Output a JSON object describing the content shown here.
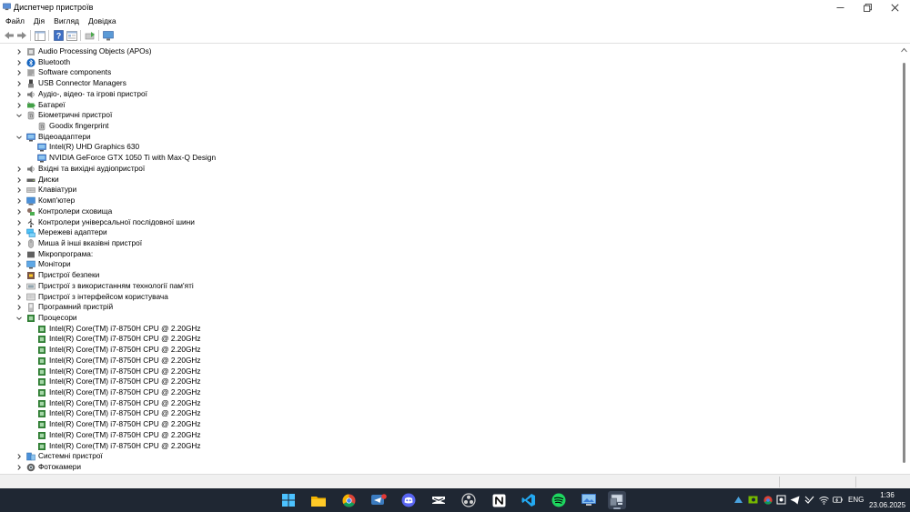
{
  "window": {
    "title": "Диспетчер пристроїв",
    "menu": [
      "Файл",
      "Дія",
      "Вигляд",
      "Довідка"
    ]
  },
  "tree": [
    {
      "level": 1,
      "expand": "collapsed",
      "icon": "audio-processing-icon",
      "label": "Audio Processing Objects (APOs)"
    },
    {
      "level": 1,
      "expand": "collapsed",
      "icon": "bluetooth-icon",
      "label": "Bluetooth"
    },
    {
      "level": 1,
      "expand": "collapsed",
      "icon": "software-component-icon",
      "label": "Software components"
    },
    {
      "level": 1,
      "expand": "collapsed",
      "icon": "usb-connector-icon",
      "label": "USB Connector Managers"
    },
    {
      "level": 1,
      "expand": "collapsed",
      "icon": "speaker-icon",
      "label": "Аудіо-, відео- та ігрові пристрої"
    },
    {
      "level": 1,
      "expand": "collapsed",
      "icon": "battery-icon",
      "label": "Батареї"
    },
    {
      "level": 1,
      "expand": "expanded",
      "icon": "biometric-icon",
      "label": "Біометричні пристрої"
    },
    {
      "level": 2,
      "expand": "none",
      "icon": "biometric-icon",
      "label": "Goodix fingerprint"
    },
    {
      "level": 1,
      "expand": "expanded",
      "icon": "display-adapter-icon",
      "label": "Відеоадаптери"
    },
    {
      "level": 2,
      "expand": "none",
      "icon": "display-adapter-icon",
      "label": "Intel(R) UHD Graphics 630"
    },
    {
      "level": 2,
      "expand": "none",
      "icon": "display-adapter-icon",
      "label": "NVIDIA GeForce GTX 1050 Ti with Max-Q Design"
    },
    {
      "level": 1,
      "expand": "collapsed",
      "icon": "speaker-icon",
      "label": "Вхідні та вихідні аудіопристрої"
    },
    {
      "level": 1,
      "expand": "collapsed",
      "icon": "disk-drive-icon",
      "label": "Диски"
    },
    {
      "level": 1,
      "expand": "collapsed",
      "icon": "keyboard-icon",
      "label": "Клавіатури"
    },
    {
      "level": 1,
      "expand": "collapsed",
      "icon": "computer-icon",
      "label": "Комп'ютер"
    },
    {
      "level": 1,
      "expand": "collapsed",
      "icon": "storage-controller-icon",
      "label": "Контролери сховища"
    },
    {
      "level": 1,
      "expand": "collapsed",
      "icon": "usb-controller-icon",
      "label": "Контролери універсальної послідовної шини"
    },
    {
      "level": 1,
      "expand": "collapsed",
      "icon": "network-adapter-icon",
      "label": "Мережеві адаптери"
    },
    {
      "level": 1,
      "expand": "collapsed",
      "icon": "mouse-icon",
      "label": "Миша й інші вказівні пристрої"
    },
    {
      "level": 1,
      "expand": "collapsed",
      "icon": "firmware-icon",
      "label": "Мікропрограма:"
    },
    {
      "level": 1,
      "expand": "collapsed",
      "icon": "monitor-icon",
      "label": "Монітори"
    },
    {
      "level": 1,
      "expand": "collapsed",
      "icon": "security-device-icon",
      "label": "Пристрої безпеки"
    },
    {
      "level": 1,
      "expand": "collapsed",
      "icon": "memory-device-icon",
      "label": "Пристрої з використанням технології пам'яті"
    },
    {
      "level": 1,
      "expand": "collapsed",
      "icon": "hid-icon",
      "label": "Пристрої з інтерфейсом користувача"
    },
    {
      "level": 1,
      "expand": "collapsed",
      "icon": "software-device-icon",
      "label": "Програмний пристрій"
    },
    {
      "level": 1,
      "expand": "expanded",
      "icon": "processor-icon",
      "label": "Процесори"
    },
    {
      "level": 2,
      "expand": "none",
      "icon": "processor-icon",
      "label": "Intel(R) Core(TM) i7-8750H CPU @ 2.20GHz"
    },
    {
      "level": 2,
      "expand": "none",
      "icon": "processor-icon",
      "label": "Intel(R) Core(TM) i7-8750H CPU @ 2.20GHz"
    },
    {
      "level": 2,
      "expand": "none",
      "icon": "processor-icon",
      "label": "Intel(R) Core(TM) i7-8750H CPU @ 2.20GHz"
    },
    {
      "level": 2,
      "expand": "none",
      "icon": "processor-icon",
      "label": "Intel(R) Core(TM) i7-8750H CPU @ 2.20GHz"
    },
    {
      "level": 2,
      "expand": "none",
      "icon": "processor-icon",
      "label": "Intel(R) Core(TM) i7-8750H CPU @ 2.20GHz"
    },
    {
      "level": 2,
      "expand": "none",
      "icon": "processor-icon",
      "label": "Intel(R) Core(TM) i7-8750H CPU @ 2.20GHz"
    },
    {
      "level": 2,
      "expand": "none",
      "icon": "processor-icon",
      "label": "Intel(R) Core(TM) i7-8750H CPU @ 2.20GHz"
    },
    {
      "level": 2,
      "expand": "none",
      "icon": "processor-icon",
      "label": "Intel(R) Core(TM) i7-8750H CPU @ 2.20GHz"
    },
    {
      "level": 2,
      "expand": "none",
      "icon": "processor-icon",
      "label": "Intel(R) Core(TM) i7-8750H CPU @ 2.20GHz"
    },
    {
      "level": 2,
      "expand": "none",
      "icon": "processor-icon",
      "label": "Intel(R) Core(TM) i7-8750H CPU @ 2.20GHz"
    },
    {
      "level": 2,
      "expand": "none",
      "icon": "processor-icon",
      "label": "Intel(R) Core(TM) i7-8750H CPU @ 2.20GHz"
    },
    {
      "level": 2,
      "expand": "none",
      "icon": "processor-icon",
      "label": "Intel(R) Core(TM) i7-8750H CPU @ 2.20GHz"
    },
    {
      "level": 1,
      "expand": "collapsed",
      "icon": "system-device-icon",
      "label": "Системні пристрої"
    },
    {
      "level": 1,
      "expand": "collapsed",
      "icon": "camera-icon",
      "label": "Фотокамери"
    }
  ],
  "taskbar": {
    "apps": [
      "start-icon",
      "file-explorer-icon",
      "chrome-icon",
      "telegram-icon",
      "discord-icon",
      "capcut-icon",
      "obs-icon",
      "notion-icon",
      "vscode-icon",
      "spotify-icon",
      "remote-desktop-icon",
      "device-manager-icon"
    ],
    "language": "ENG",
    "time": "1:36",
    "date": "23.06.2025"
  },
  "colors": {
    "taskbar_bg": "#1f2733",
    "processor": "#2e7d32",
    "display": "#3a7bd5"
  }
}
